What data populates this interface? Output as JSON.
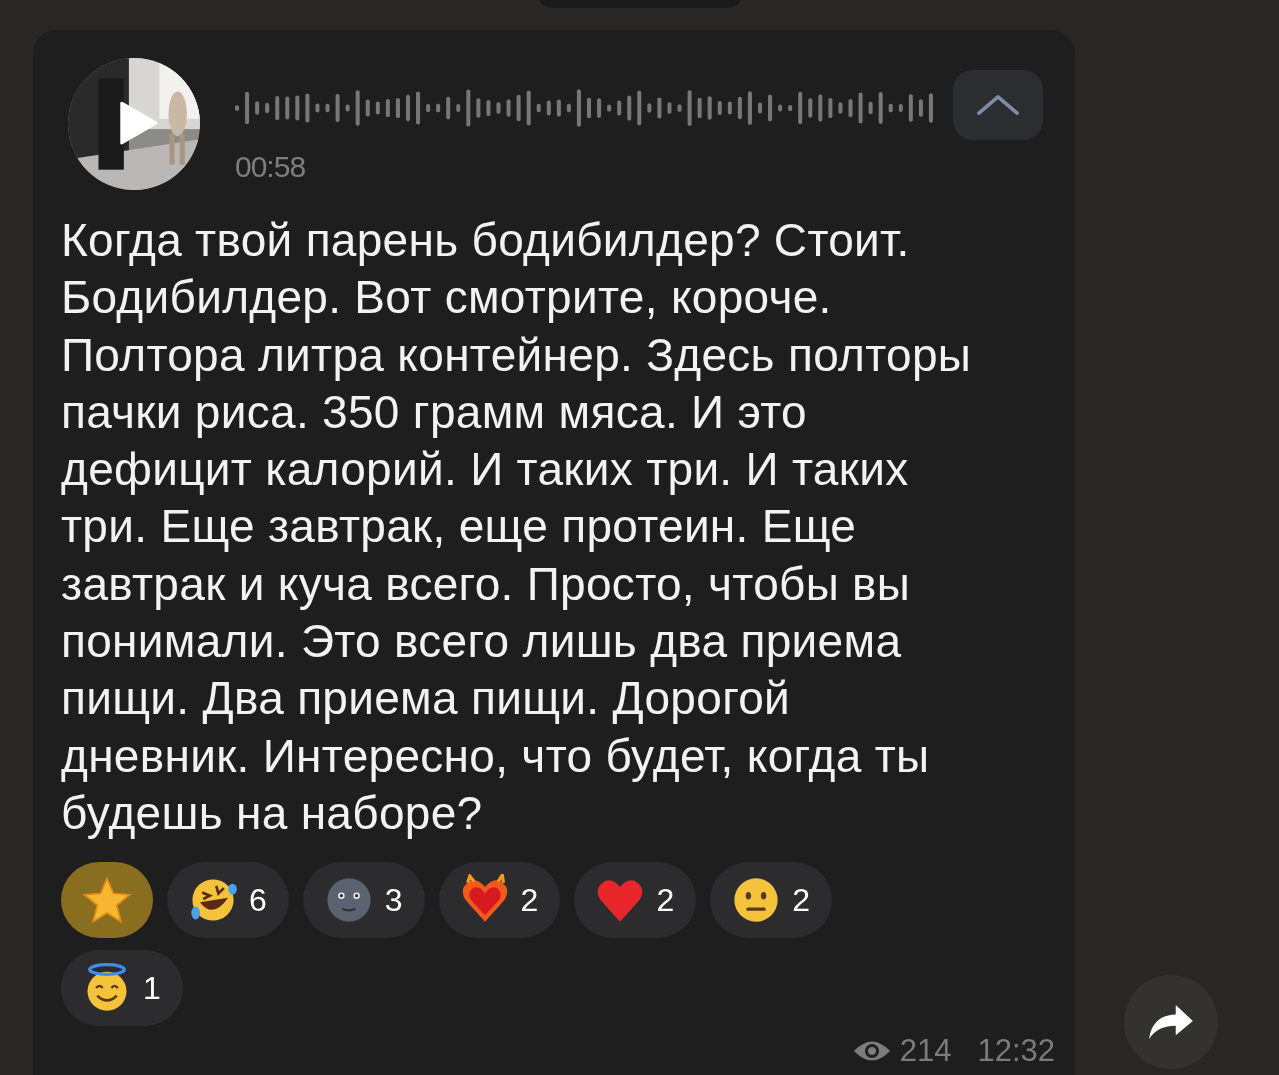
{
  "voice_message": {
    "duration": "00:58",
    "transcript_expanded": true
  },
  "transcript": "Когда твой парень бодибилдер? Стоит.\nБодибилдер. Вот смотрите, короче.\nПолтора литра контейнер. Здесь полторы\nпачки риса. 350 грамм мяса. И это\nдефицит калорий. И таких три. И таких\nтри. Еще завтрак, еще протеин. Еще\nзавтрак и куча всего. Просто, чтобы вы\nпонимали. Это всего лишь два приема\nпищи. Два приема пищи. Дорогой\nдневник. Интересно, что будет, когда ты\nбудешь на наборе?",
  "reactions": [
    {
      "kind": "star",
      "selected": true
    },
    {
      "kind": "laughing",
      "count": "6",
      "selected": false
    },
    {
      "kind": "moon",
      "count": "3",
      "selected": false
    },
    {
      "kind": "heart-fire",
      "count": "2",
      "selected": false
    },
    {
      "kind": "heart",
      "count": "2",
      "selected": false
    },
    {
      "kind": "neutral",
      "count": "2",
      "selected": false
    },
    {
      "kind": "halo",
      "count": "1",
      "selected": false
    }
  ],
  "views": "214",
  "time": "12:32"
}
